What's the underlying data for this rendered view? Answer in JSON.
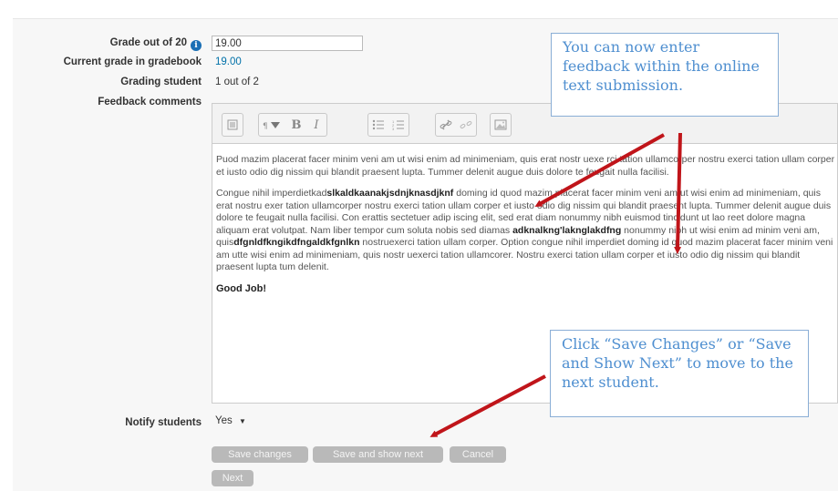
{
  "form": {
    "grade_label": "Grade out of 20",
    "grade_value": "19.00",
    "current_grade_label": "Current grade in gradebook",
    "current_grade_value": "19.00",
    "grading_student_label": "Grading student",
    "grading_student_value": "1 out of 2",
    "feedback_label": "Feedback comments",
    "notify_label": "Notify students",
    "notify_value": "Yes"
  },
  "editor": {
    "toolbar_icons": [
      "collapse-icon",
      "styles-icon",
      "bold-icon",
      "italic-icon",
      "unordered-list-icon",
      "ordered-list-icon",
      "link-icon",
      "unlink-icon",
      "image-icon"
    ],
    "bold_label": "B",
    "italic_label": "I",
    "para1": "Puod mazim placerat facer minim veni am ut wisi enim ad minimeniam, quis erat nostr uexe rci tation ullamcorper nostru exerci tation ullam corper et iusto odio dig nissim qui blandit praesent lupta. Tummer delenit augue duis dolore te feugait nulla facilisi.",
    "para2_a": "Congue nihil imperdietkad",
    "para2_b": "slkaldkaanakjsdnjknasdjknf",
    "para2_c": " doming id quod mazim placerat facer minim veni am ut wisi enim ad minimeniam, quis erat nostru exer tation ullamcorper nostru exerci tation ullam corper et iusto odio dig nissim qui blandit praesent lupta. Tummer delenit augue duis dolore te feugait nulla facilisi. Con erattis sectetuer adip iscing elit, sed erat diam nonummy nibh euismod tincidunt ut lao reet dolore magna aliquam erat volutpat. Nam liber tempor cum soluta nobis sed diamas ",
    "para2_d": "adknalkng'laknglakdfng",
    "para2_e": " nonummy nibh ut wisi enim ad minim veni am, quis",
    "para2_f": "dfgnldfkngikdfngaldkfgnlkn",
    "para2_g": " nostruexerci tation ullam corper. Option congue nihil imperdiet doming id quod mazim placerat facer minim veni am utte wisi enim ad minimeniam, quis nostr uexerci tation ullamcorer. Nostru exerci tation ullam corper et iusto odio dig nissim qui blandit praesent lupta tum delenit.",
    "closing": "Good Job!"
  },
  "callouts": {
    "top": "You can now enter feedback within the online text submission.",
    "bottom": "Click “Save Changes” or “Save and Show Next” to move to the next student."
  },
  "buttons": {
    "save": "Save changes",
    "save_next": "Save and show next",
    "cancel": "Cancel",
    "next": "Next"
  },
  "colors": {
    "link": "#0070a8",
    "callout_text": "#4f8fd0",
    "arrow": "#c0151a",
    "button_disabled": "#b9b9b9"
  }
}
